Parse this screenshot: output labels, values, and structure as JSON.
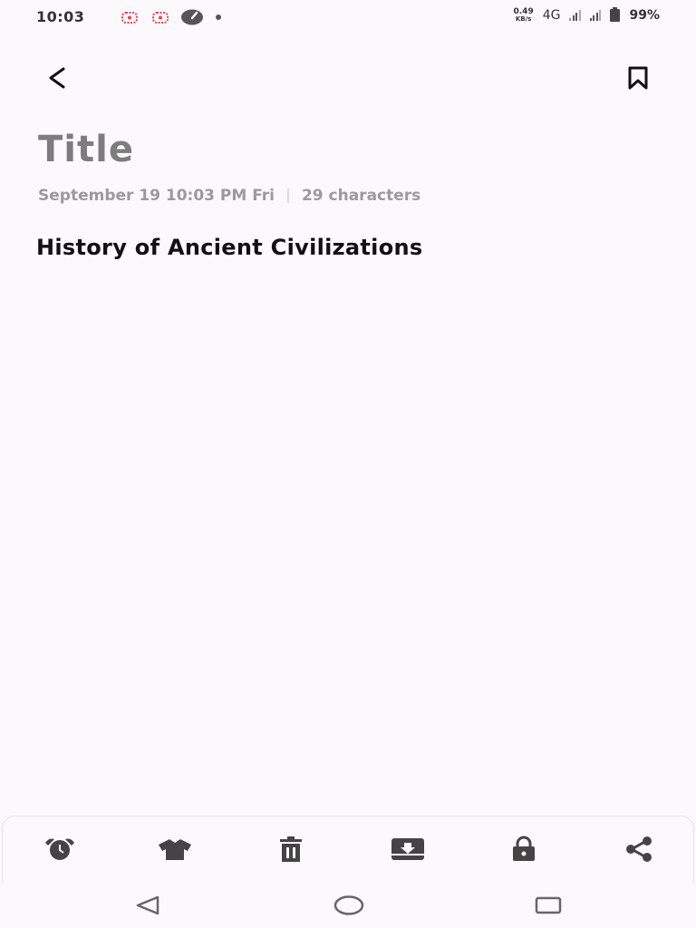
{
  "status_bar": {
    "time": "10:03",
    "net_speed_value": "0.49",
    "net_speed_unit": "KB/s",
    "network_type": "4G",
    "battery": "99%",
    "notification_icons": [
      "app-notification-icon",
      "app-notification-icon",
      "speedometer-icon",
      "dot-icon"
    ]
  },
  "header": {
    "back_icon": "chevron-left-icon",
    "bookmark_icon": "bookmark-icon"
  },
  "note": {
    "title": "Title",
    "date": "September 19 10:03 PM Fri",
    "char_count": "29 characters",
    "body": "History of Ancient Civilizations"
  },
  "toolbar": {
    "items": [
      "alarm-clock-icon",
      "shirt-icon",
      "trash-icon",
      "inbox-download-icon",
      "lock-icon",
      "share-icon"
    ]
  },
  "nav": {
    "items": [
      "back-triangle-icon",
      "home-circle-icon",
      "recents-square-icon"
    ]
  },
  "colors": {
    "background": "#fcf9fc",
    "title_gray": "#7d7d7d",
    "meta_gray": "#9a9a9a",
    "icon_dark": "#444444"
  }
}
